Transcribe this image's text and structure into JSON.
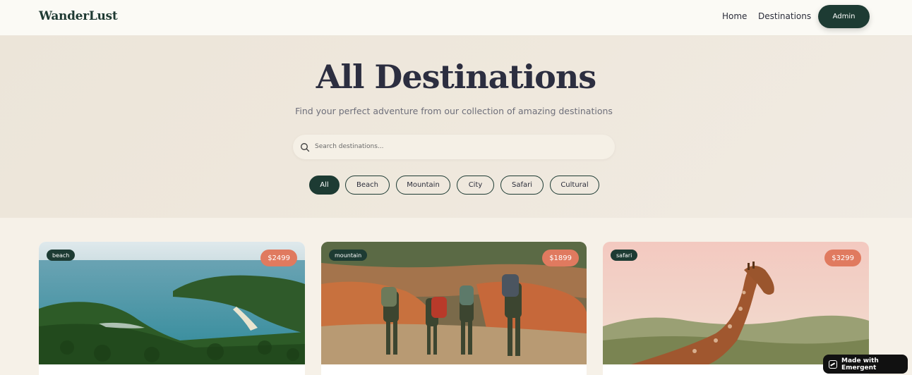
{
  "header": {
    "logo": "WanderLust",
    "nav": [
      {
        "label": "Home"
      },
      {
        "label": "Destinations"
      }
    ],
    "admin_label": "Admin"
  },
  "hero": {
    "title": "All Destinations",
    "subtitle": "Find your perfect adventure from our collection of amazing destinations",
    "search": {
      "placeholder": "Search destinations...",
      "value": "",
      "icon": "search-icon"
    },
    "filters": [
      {
        "label": "All",
        "active": true
      },
      {
        "label": "Beach",
        "active": false
      },
      {
        "label": "Mountain",
        "active": false
      },
      {
        "label": "City",
        "active": false
      },
      {
        "label": "Safari",
        "active": false
      },
      {
        "label": "Cultural",
        "active": false
      }
    ]
  },
  "cards": [
    {
      "category": "beach",
      "price": "$2499",
      "image": "tropical-beach-photo"
    },
    {
      "category": "mountain",
      "price": "$1899",
      "image": "hikers-canyon-photo"
    },
    {
      "category": "safari",
      "price": "$3299",
      "image": "giraffe-photo"
    }
  ],
  "badge": {
    "label": "Made with Emergent",
    "icon": "emergent-logo-icon"
  },
  "colors": {
    "primary": "#1d3b33",
    "accent": "#e07a5f",
    "background": "#f6f1e8",
    "header_bg": "#fbfaf5",
    "title": "#2c2e40"
  }
}
